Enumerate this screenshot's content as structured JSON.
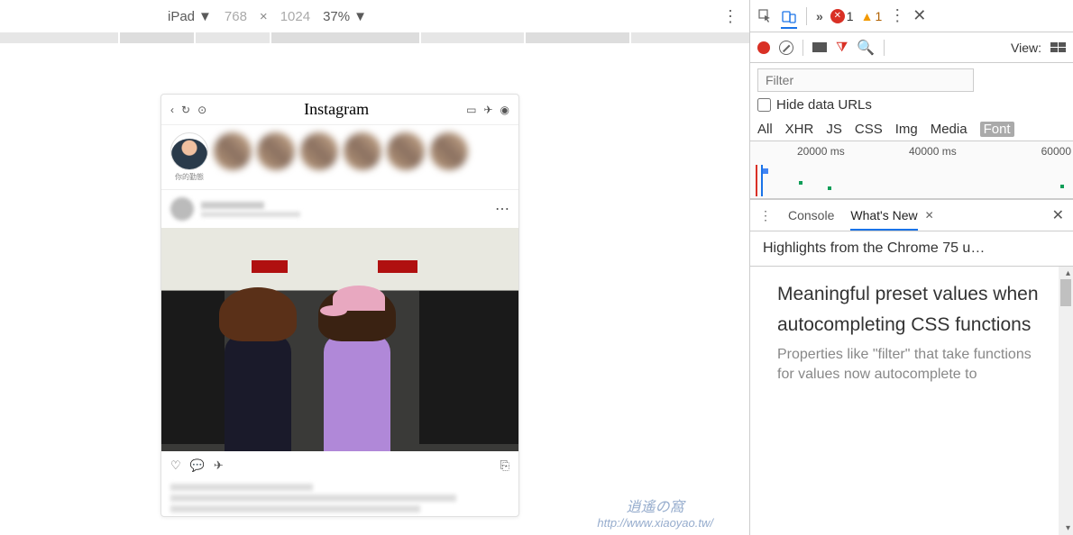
{
  "deviceToolbar": {
    "device": "iPad",
    "width": "768",
    "x": "×",
    "height": "1024",
    "zoom": "37%"
  },
  "instagram": {
    "logo": "Instagram",
    "storyLabel": "你的勤態"
  },
  "watermark": {
    "top": "逍遙の窩",
    "url": "http://www.xiaoyao.tw/"
  },
  "devtoolsTop": {
    "chevrons": "»",
    "errCount": "1",
    "warnCount": "1"
  },
  "network": {
    "viewLabel": "View:",
    "filterPlaceholder": "Filter",
    "hideDataUrls": "Hide data URLs",
    "tabs": [
      "All",
      "XHR",
      "JS",
      "CSS",
      "Img",
      "Media",
      "Font"
    ],
    "activeTab": "Font",
    "timeline": {
      "t1": "20000 ms",
      "t2": "40000 ms",
      "t3": "60000"
    }
  },
  "drawer": {
    "tabs": {
      "console": "Console",
      "whatsNew": "What's New"
    },
    "highlights": "Highlights from the Chrome 75 u…",
    "heading": "Meaningful preset values when autocompleting CSS functions",
    "body": "Properties like \"filter\" that take functions for values now autocomplete to"
  }
}
